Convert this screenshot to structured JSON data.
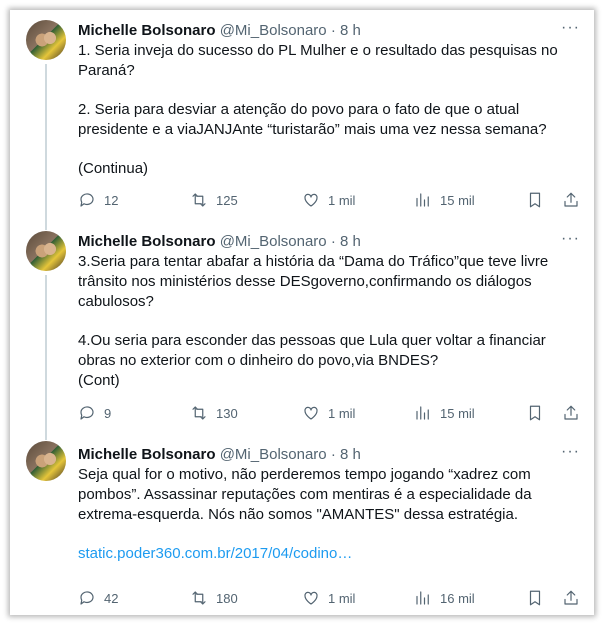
{
  "tweets": [
    {
      "name": "Michelle Bolsonaro",
      "handle": "@Mi_Bolsonaro",
      "time": "8 h",
      "paragraphs": [
        "1. Seria inveja do sucesso do PL Mulher e o resultado das pesquisas no Paraná?",
        "2. Seria para desviar a atenção do povo para o fato de que o atual presidente e a viaJANJAnte “turistarão” mais uma vez nessa semana?",
        "(Continua)"
      ],
      "replies": "12",
      "retweets": "125",
      "likes": "1 mil",
      "views": "15 mil"
    },
    {
      "name": "Michelle Bolsonaro",
      "handle": "@Mi_Bolsonaro",
      "time": "8 h",
      "paragraphs": [
        "3.Seria para tentar abafar a história da “Dama do Tráfico”que teve livre trânsito nos ministérios desse DESgoverno,confirmando os diálogos cabulosos?",
        "4.Ou seria para esconder das pessoas que Lula quer voltar a financiar obras no exterior com o dinheiro do povo,via BNDES?",
        "(Cont)"
      ],
      "replies": "9",
      "retweets": "130",
      "likes": "1 mil",
      "views": "15 mil"
    },
    {
      "name": "Michelle Bolsonaro",
      "handle": "@Mi_Bolsonaro",
      "time": "8 h",
      "paragraphs": [
        "Seja qual for o motivo, não perderemos tempo jogando “xadrez com pombos”. Assassinar reputações com mentiras é a especialidade da extrema-esquerda. Nós não somos \"AMANTES\" dessa estratégia.",
        "static.poder360.com.br/2017/04/codino…"
      ],
      "replies": "42",
      "retweets": "180",
      "likes": "1 mil",
      "views": "16 mil"
    }
  ],
  "more_glyph": "···",
  "separator": " · "
}
